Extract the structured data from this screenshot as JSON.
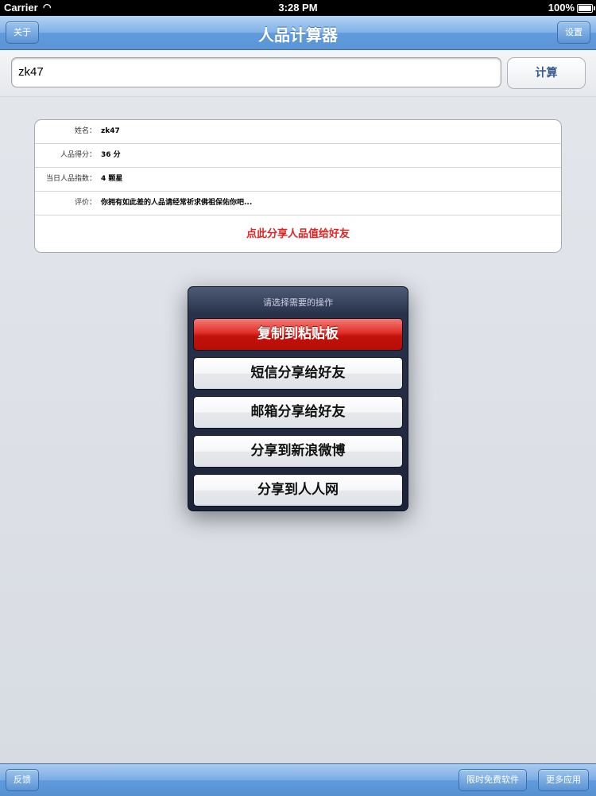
{
  "status_bar": {
    "carrier": "Carrier",
    "time": "3:28 PM",
    "battery": "100%"
  },
  "nav": {
    "title": "人品计算器",
    "left_button": "关于",
    "right_button": "设置"
  },
  "input": {
    "value": "zk47",
    "calc_button": "计算"
  },
  "result": {
    "rows": [
      {
        "label": "姓名：",
        "value": "zk47"
      },
      {
        "label": "人品得分：",
        "value": "36 分"
      },
      {
        "label": "当日人品指数：",
        "value": "4 颗星"
      },
      {
        "label": "评价：",
        "value": "你拥有如此差的人品请经常祈求佛祖保佑你吧..."
      }
    ],
    "share_link": "点此分享人品值给好友"
  },
  "action_sheet": {
    "prompt": "请选择需要的操作",
    "buttons": [
      "复制到粘贴板",
      "短信分享给好友",
      "邮箱分享给好友",
      "分享到新浪微博",
      "分享到人人网"
    ]
  },
  "toolbar": {
    "left_button": "反馈",
    "free_apps_button": "限时免费软件",
    "more_apps_button": "更多应用"
  }
}
